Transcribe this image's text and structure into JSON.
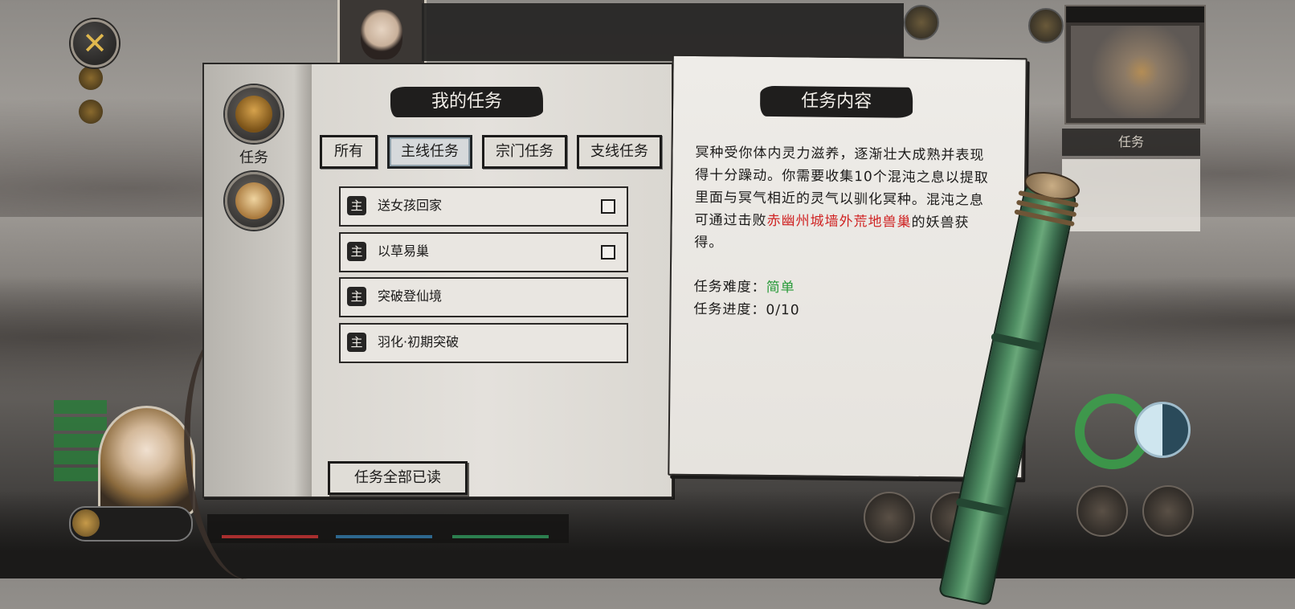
{
  "hud": {
    "close_glyph": "✕",
    "task_tab_label": "任务"
  },
  "sidebar": {
    "items": [
      {
        "label": "任务",
        "icon": "scroll-icon"
      },
      {
        "label": "",
        "icon": "letters-icon"
      }
    ]
  },
  "left_page": {
    "title": "我的任务",
    "tabs": [
      {
        "label": "所有",
        "active": false
      },
      {
        "label": "主线任务",
        "active": true
      },
      {
        "label": "宗门任务",
        "active": false
      },
      {
        "label": "支线任务",
        "active": false
      }
    ],
    "tasks": [
      {
        "badge": "主",
        "name": "送女孩回家",
        "has_checkbox": true
      },
      {
        "badge": "主",
        "name": "以草易巢",
        "has_checkbox": true
      },
      {
        "badge": "主",
        "name": "突破登仙境",
        "has_checkbox": false
      },
      {
        "badge": "主",
        "name": "羽化·初期突破",
        "has_checkbox": false
      }
    ],
    "mark_all_read": "任务全部已读"
  },
  "right_page": {
    "title": "任务内容",
    "description_before": "冥种受你体内灵力滋养，逐渐壮大成熟并表现得十分躁动。你需要收集10个混沌之息以提取里面与冥气相近的灵气以驯化冥种。混沌之息可通过击败",
    "description_highlight": "赤幽州城墙外荒地兽巢",
    "description_after": "的妖兽获得。",
    "difficulty_label": "任务难度：",
    "difficulty_value": "简单",
    "progress_label": "任务进度：",
    "progress_value": "0/10"
  },
  "colors": {
    "highlight_red": "#d02424",
    "difficulty_green": "#2a9b3a",
    "ink": "#1c1b1a",
    "paper": "#e6e3de"
  }
}
